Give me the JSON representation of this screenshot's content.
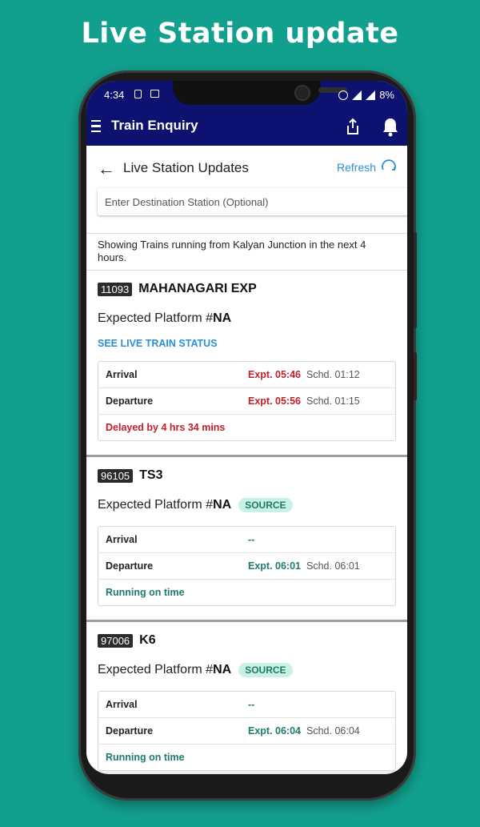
{
  "promo_title": "Live Station update",
  "status_bar": {
    "time": "4:34",
    "battery": "8%"
  },
  "app_bar": {
    "title": "Train Enquiry"
  },
  "header": {
    "title": "Live Station Updates",
    "refresh_label": "Refresh",
    "destination_placeholder": "Enter Destination Station (Optional)"
  },
  "info_text": "Showing Trains running from Kalyan Junction in the next 4 hours.",
  "labels": {
    "arrival": "Arrival",
    "departure": "Departure",
    "expected_platform": "Expected Platform #"
  },
  "trains": [
    {
      "number": "11093",
      "name": "MAHANAGARI EXP",
      "platform": "NA",
      "badge": "",
      "live_link": "SEE LIVE TRAIN STATUS",
      "arrival_expt": "Expt. 05:46",
      "arrival_schd": "Schd. 01:12",
      "departure_expt": "Expt. 05:56",
      "departure_schd": "Schd. 01:15",
      "status": "Delayed by 4 hrs 34 mins"
    },
    {
      "number": "96105",
      "name": "TS3",
      "platform": "NA",
      "badge": "SOURCE",
      "arrival_expt": "--",
      "arrival_schd": "",
      "departure_expt": "Expt. 06:01",
      "departure_schd": "Schd. 06:01",
      "status": "Running on time"
    },
    {
      "number": "97006",
      "name": "K6",
      "platform": "NA",
      "badge": "SOURCE",
      "arrival_expt": "--",
      "arrival_schd": "",
      "departure_expt": "Expt. 06:04",
      "departure_schd": "Schd. 06:04",
      "status": "Running on time"
    }
  ],
  "colors": {
    "background": "#12a08e",
    "app_bar": "#0d1170",
    "delayed": "#c0202a",
    "on_time": "#1f7a6e",
    "link": "#2a8fd6"
  }
}
